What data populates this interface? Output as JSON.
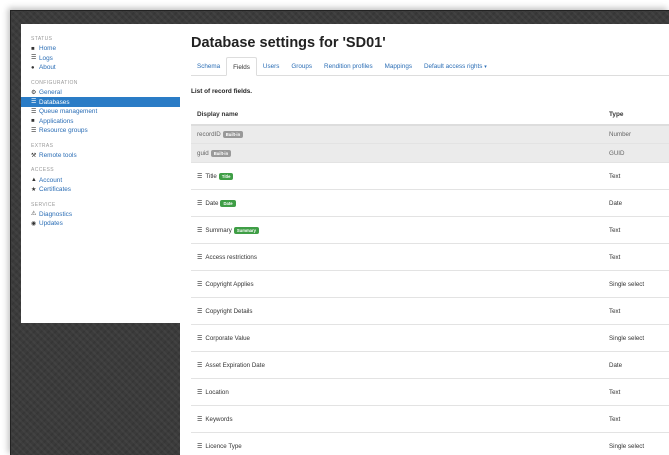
{
  "sidebar": {
    "sections": [
      {
        "heading": "Status",
        "items": [
          {
            "label": "Home",
            "icon": "home-icon",
            "glyph": "■"
          },
          {
            "label": "Logs",
            "icon": "logs-icon",
            "glyph": "☰"
          },
          {
            "label": "About",
            "icon": "info-icon",
            "glyph": "●"
          }
        ]
      },
      {
        "heading": "Configuration",
        "items": [
          {
            "label": "General",
            "icon": "gear-icon",
            "glyph": "⚙"
          },
          {
            "label": "Databases",
            "icon": "database-icon",
            "glyph": "☰"
          },
          {
            "label": "Queue management",
            "icon": "queue-icon",
            "glyph": "☰"
          },
          {
            "label": "Applications",
            "icon": "applications-icon",
            "glyph": "■"
          },
          {
            "label": "Resource groups",
            "icon": "resource-groups-icon",
            "glyph": "☰"
          }
        ]
      },
      {
        "heading": "Extras",
        "items": [
          {
            "label": "Remote tools",
            "icon": "wrench-icon",
            "glyph": "⚒"
          }
        ]
      },
      {
        "heading": "Access",
        "items": [
          {
            "label": "Account",
            "icon": "user-icon",
            "glyph": "▲"
          },
          {
            "label": "Certificates",
            "icon": "certificate-icon",
            "glyph": "★"
          }
        ]
      },
      {
        "heading": "Service",
        "items": [
          {
            "label": "Diagnostics",
            "icon": "warning-icon",
            "glyph": "⚠"
          },
          {
            "label": "Updates",
            "icon": "updates-icon",
            "glyph": "◉"
          }
        ]
      }
    ],
    "active": "Databases"
  },
  "main": {
    "title": "Database settings for 'SD01'",
    "tabs": [
      {
        "label": "Schema"
      },
      {
        "label": "Fields",
        "active": true
      },
      {
        "label": "Users"
      },
      {
        "label": "Groups"
      },
      {
        "label": "Rendition profiles"
      },
      {
        "label": "Mappings"
      },
      {
        "label": "Default access rights",
        "dropdown": true,
        "caret": "▾"
      }
    ],
    "list_caption": "List of record fields.",
    "table": {
      "columns": [
        "Display name",
        "Type"
      ],
      "handle_glyph": "☰",
      "rows": [
        {
          "name": "recordID",
          "badge": "Built-in",
          "badge_color": "grey",
          "type": "Number",
          "system": true
        },
        {
          "name": "guid",
          "badge": "Built-in",
          "badge_color": "grey",
          "type": "GUID",
          "system": true
        },
        {
          "name": "Title",
          "badge": "Title",
          "badge_color": "green",
          "type": "Text"
        },
        {
          "name": "Date",
          "badge": "Date",
          "badge_color": "green",
          "type": "Date"
        },
        {
          "name": "Summary",
          "badge": "Summary",
          "badge_color": "green",
          "type": "Text"
        },
        {
          "name": "Access restrictions",
          "type": "Text"
        },
        {
          "name": "Copyright Applies",
          "type": "Single select"
        },
        {
          "name": "Copyright Details",
          "type": "Text"
        },
        {
          "name": "Corporate Value",
          "type": "Single select"
        },
        {
          "name": "Asset Expiration Date",
          "type": "Date"
        },
        {
          "name": "Location",
          "type": "Text"
        },
        {
          "name": "Keywords",
          "type": "Text"
        },
        {
          "name": "Licence Type",
          "type": "Single select"
        }
      ]
    }
  },
  "colors": {
    "accent": "#2a7cc6",
    "link": "#2a6db5",
    "badge_green": "#3f9e46",
    "badge_grey": "#999999",
    "backdrop": "#3b3b3b"
  }
}
